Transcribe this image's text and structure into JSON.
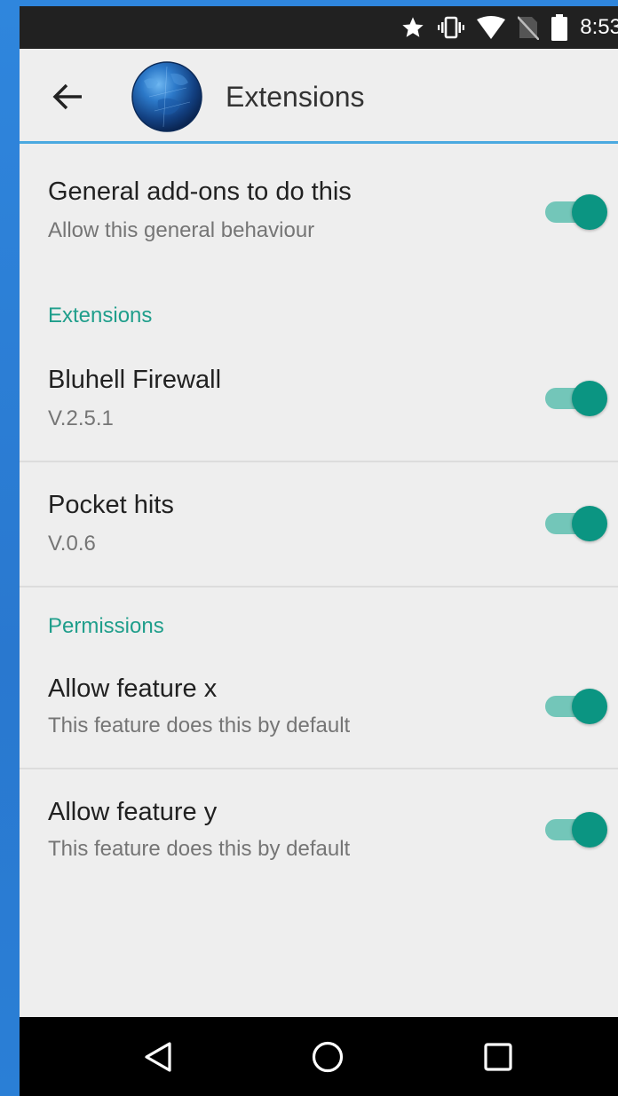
{
  "status_bar": {
    "time": "8:53",
    "icons": [
      "star-icon",
      "vibrate-icon",
      "wifi-icon",
      "no-sim-icon",
      "battery-icon"
    ]
  },
  "app_bar": {
    "title": "Extensions",
    "logo": "globe-logo",
    "back_icon": "arrow-back-icon"
  },
  "general": {
    "title": "General add-ons to do this",
    "summary": "Allow this general behaviour",
    "enabled": true
  },
  "extensions_section": {
    "header": "Extensions",
    "items": [
      {
        "title": "Bluhell Firewall",
        "summary": "V.2.5.1",
        "enabled": true
      },
      {
        "title": "Pocket hits",
        "summary": "V.0.6",
        "enabled": true
      }
    ]
  },
  "permissions_section": {
    "header": "Permissions",
    "items": [
      {
        "title": "Allow feature x",
        "summary": "This feature does this by default",
        "enabled": true
      },
      {
        "title": "Allow feature y",
        "summary": "This feature does this by default",
        "enabled": true
      }
    ]
  },
  "colors": {
    "accent": "#1f9e8b",
    "switch_thumb": "#0b9582",
    "switch_track": "#73c6b9",
    "app_bar_underline": "#4aa9e0",
    "background": "#eeeeee"
  },
  "nav_bar": {
    "icons": [
      "back-triangle-icon",
      "home-circle-icon",
      "recents-square-icon"
    ]
  }
}
